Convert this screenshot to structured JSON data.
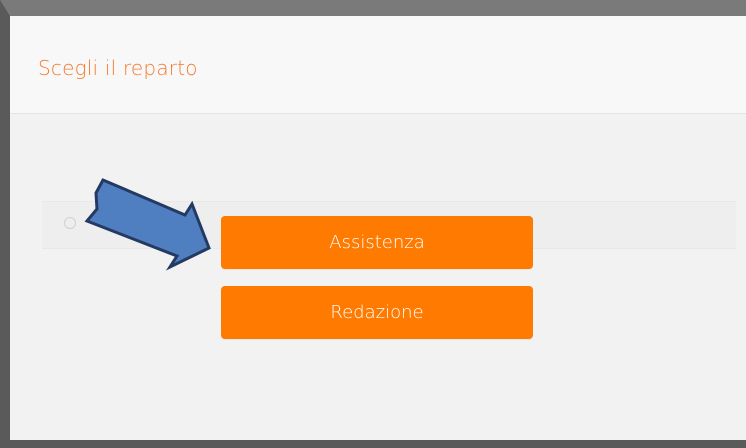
{
  "dialog": {
    "title": "Scegli il reparto"
  },
  "buttons": {
    "assistenza_label": "Assistenza",
    "redazione_label": "Redazione"
  },
  "colors": {
    "title": "#f47a2e",
    "button_bg": "#ff7a00",
    "button_text": "#ffffff",
    "arrow_fill": "#4f7fc1",
    "arrow_stroke": "#243a63"
  },
  "annotation": {
    "icon": "arrow-pointing-right-icon"
  }
}
